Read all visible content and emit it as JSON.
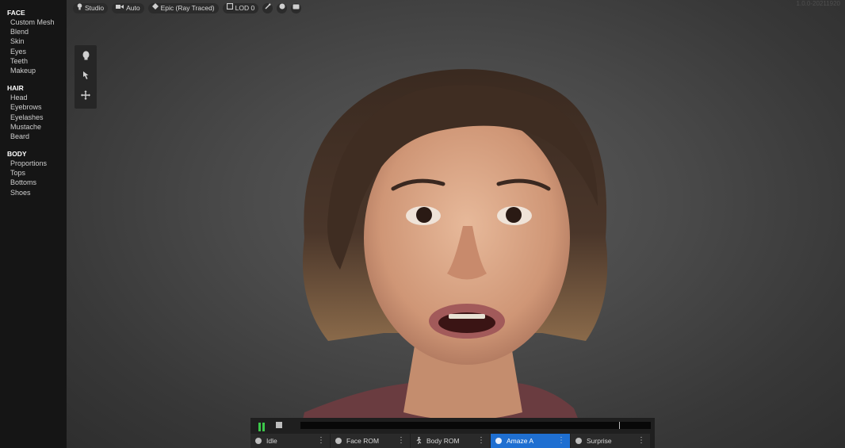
{
  "sidebar": {
    "sections": [
      {
        "title": "FACE",
        "items": [
          "Custom Mesh",
          "Blend",
          "Skin",
          "Eyes",
          "Teeth",
          "Makeup"
        ]
      },
      {
        "title": "HAIR",
        "items": [
          "Head",
          "Eyebrows",
          "Eyelashes",
          "Mustache",
          "Beard"
        ]
      },
      {
        "title": "BODY",
        "items": [
          "Proportions",
          "Tops",
          "Bottoms",
          "Shoes"
        ]
      }
    ]
  },
  "topbar": {
    "studio": "Studio",
    "auto": "Auto",
    "quality": "Epic (Ray Traced)",
    "lod": "LOD 0"
  },
  "version": "1.0.0-20211920",
  "player": {
    "progress": 0.91,
    "animations": [
      "Idle",
      "Face ROM",
      "Body ROM",
      "Amaze A",
      "Surprise"
    ],
    "active_index": 3
  },
  "colors": {
    "accent": "#1f6fd1",
    "play": "#3cc84a"
  }
}
